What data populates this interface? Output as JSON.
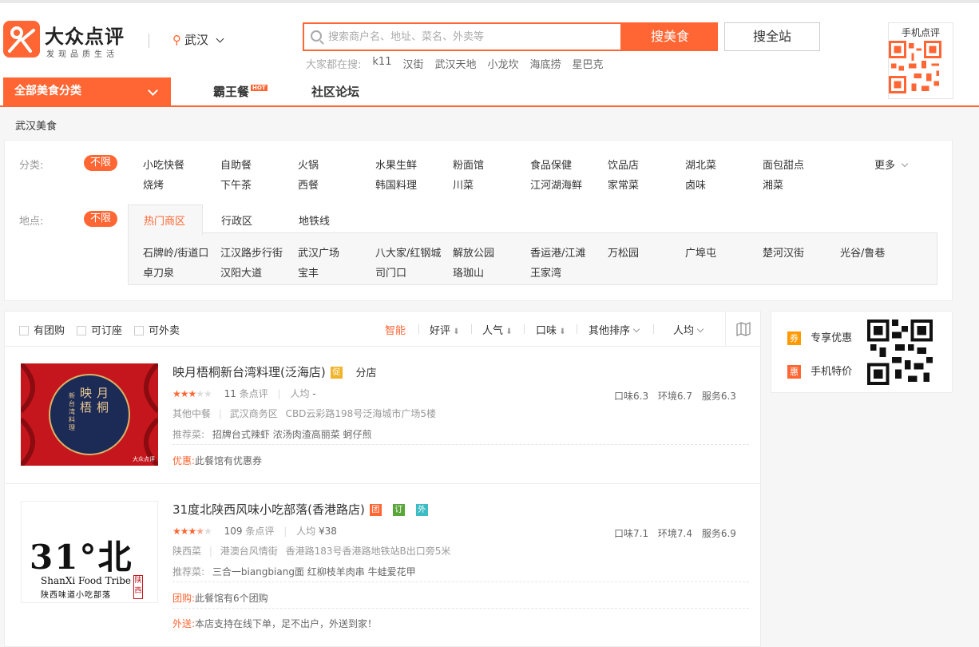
{
  "header": {
    "logo_text": "大众点评",
    "slogan": "发现品质生活",
    "city": "武汉",
    "search_placeholder": "搜索商户名、地址、菜名、外卖等",
    "search_button": "搜美食",
    "search_all_button": "搜全站",
    "hot_label": "大家都在搜:",
    "hot_keywords": [
      "k11",
      "汉街",
      "武汉天地",
      "小龙坎",
      "海底捞",
      "星巴克"
    ],
    "qr_label": "手机点评"
  },
  "nav": {
    "all_categories": "全部美食分类",
    "items": [
      "霸王餐",
      "社区论坛"
    ],
    "hot_tag": "HOT"
  },
  "breadcrumb": "武汉美食",
  "filters": {
    "category_label": "分类:",
    "location_label": "地点:",
    "unlimited": "不限",
    "more": "更多",
    "categories_row1": [
      "小吃快餐",
      "自助餐",
      "火锅",
      "水果生鲜",
      "粉面馆",
      "食品保健",
      "饮品店",
      "湖北菜",
      "面包甜点"
    ],
    "categories_row2": [
      "烧烤",
      "下午茶",
      "西餐",
      "韩国料理",
      "川菜",
      "江河湖海鲜",
      "家常菜",
      "卤味",
      "湘菜"
    ],
    "location_tabs": [
      "热门商区",
      "行政区",
      "地铁线"
    ],
    "locations_row1": [
      "石牌岭/街道口",
      "江汉路步行街",
      "武汉广场",
      "八大家/红钢城",
      "解放公园",
      "香运港/江滩",
      "万松园",
      "广埠屯",
      "楚河汉街",
      "光谷/鲁巷"
    ],
    "locations_row2": [
      "卓刀泉",
      "汉阳大道",
      "宝丰",
      "司门口",
      "珞珈山",
      "王家湾"
    ]
  },
  "sort_bar": {
    "checkboxes": [
      "有团购",
      "可订座",
      "可外卖"
    ],
    "sorts": [
      "智能",
      "好评",
      "人气",
      "口味",
      "其他排序",
      "人均"
    ]
  },
  "shops": [
    {
      "name": "映月梧桐新台湾料理(泛海店)",
      "badges": [
        {
          "text": "促",
          "color": "#f0b42a"
        }
      ],
      "branch": "分店",
      "stars": 3,
      "reviews": "11",
      "reviews_label": "条点评",
      "avg_label": "人均",
      "avg": "-",
      "cuisine": "其他中餐",
      "district": "武汉商务区",
      "address": "CBD云彩路198号泛海城市广场5楼",
      "rec_label": "推荐菜:",
      "dishes": [
        "招牌台式辣虾",
        "浓汤肉渣高丽菜",
        "蚵仔煎"
      ],
      "scores": [
        "口味6.3",
        "环境6.7",
        "服务6.3"
      ],
      "promos": [
        {
          "key": "优惠:",
          "text": "此餐馆有优惠券"
        }
      ],
      "img_text": [
        "映",
        "月",
        "梧",
        "桐"
      ],
      "img_side_text": "新台湾料理",
      "img_corner": "大众点评"
    },
    {
      "name": "31度北陕西风味小吃部落(香港路店)",
      "badges": [
        {
          "text": "团",
          "color": "#f63"
        },
        {
          "text": "订",
          "color": "#5aa63a"
        },
        {
          "text": "外",
          "color": "#3dbdc3"
        }
      ],
      "branch": "",
      "stars": 3.5,
      "reviews": "109",
      "reviews_label": "条点评",
      "avg_label": "人均",
      "avg": "¥38",
      "cuisine": "陕西菜",
      "district": "港澳台风情街",
      "address": "香港路183号香港路地铁站B出口旁5米",
      "rec_label": "推荐菜:",
      "dishes": [
        "三合一biangbiang面",
        "红柳枝羊肉串",
        "牛蛙爱花甲"
      ],
      "scores": [
        "口味7.1",
        "环境7.4",
        "服务6.9"
      ],
      "promos": [
        {
          "key": "团购:",
          "text": "此餐馆有6个团购"
        },
        {
          "key": "外送:",
          "text": "本店支持在线下单，足不出户，外送到家！"
        }
      ],
      "img_logo": "31°北",
      "img_en": "ShanXi Food Tribe",
      "img_cn": "陕西味道小吃部落",
      "img_seal": "陕西"
    }
  ],
  "side": {
    "items": [
      {
        "tag": "券",
        "text": "专享优惠"
      },
      {
        "tag": "惠",
        "text": "手机特价"
      }
    ]
  },
  "colors": {
    "accent": "#ff6633",
    "star": "#ff6633"
  }
}
